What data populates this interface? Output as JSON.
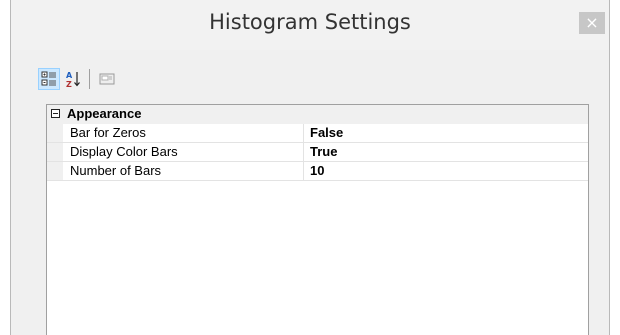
{
  "window": {
    "title": "Histogram Settings",
    "close_glyph": "×"
  },
  "toolbar": {
    "buttons": [
      {
        "icon": "categorized-icon",
        "active": true
      },
      {
        "icon": "sort-alphabetical-icon",
        "active": false
      },
      {
        "icon": "property-pages-icon",
        "active": false
      }
    ]
  },
  "property_grid": {
    "category": "Appearance",
    "properties": [
      {
        "name": "Bar for Zeros",
        "value": "False"
      },
      {
        "name": "Display Color Bars",
        "value": "True"
      },
      {
        "name": "Number of Bars",
        "value": "10"
      }
    ]
  },
  "colors": {
    "selected_button": "#cce8ff",
    "grid_background": "#ffffff",
    "category_background": "#f0f0f0"
  }
}
